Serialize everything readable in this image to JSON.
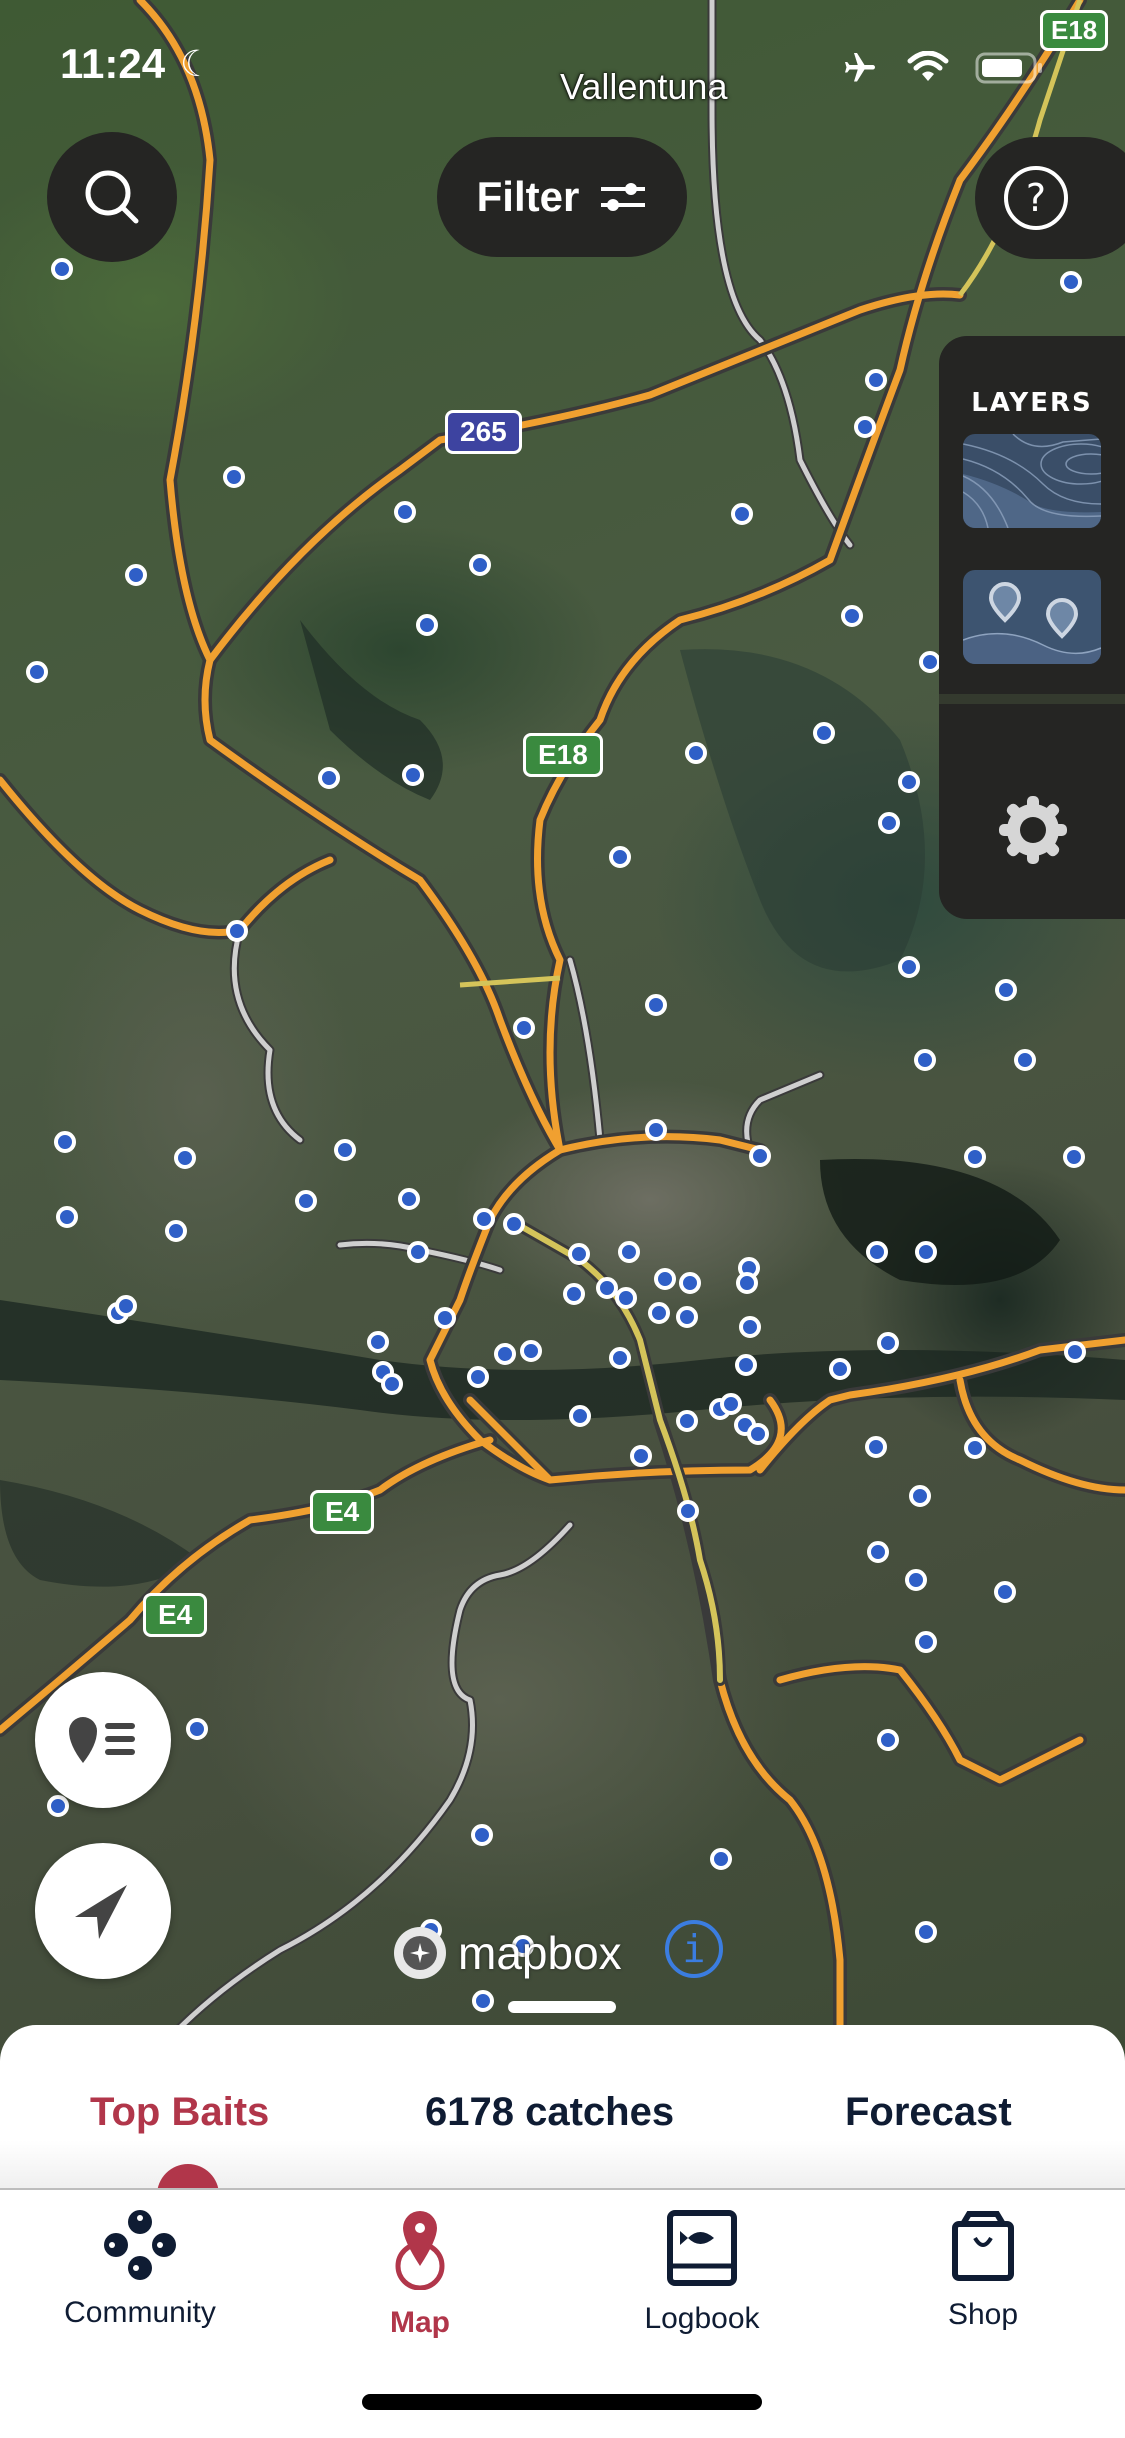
{
  "status_bar": {
    "time": "11:24",
    "icons": [
      "moon-icon",
      "airplane-icon",
      "wifi-icon",
      "battery-icon"
    ]
  },
  "map": {
    "place_label": "Vallentuna",
    "road_shields": [
      {
        "label": "E18",
        "type": "european",
        "color": "#3a8a3f"
      },
      {
        "label": "265",
        "type": "national",
        "color": "#3d43a0"
      },
      {
        "label": "E18",
        "type": "european",
        "color": "#3a8a3f"
      },
      {
        "label": "E4",
        "type": "european",
        "color": "#3a8a3f"
      },
      {
        "label": "E4",
        "type": "european",
        "color": "#3a8a3f"
      }
    ],
    "marker_color": "#2f5fc7",
    "attribution": "mapbox"
  },
  "top_controls": {
    "search_icon": "search-icon",
    "filter_label": "Filter",
    "help_icon": "question-circle-icon"
  },
  "layers_panel": {
    "title": "LAYERS",
    "items": [
      "depth-contours-layer",
      "catch-pins-layer"
    ],
    "settings_icon": "gear-icon"
  },
  "map_buttons": [
    "pin-list-icon",
    "location-arrow-icon"
  ],
  "sheet": {
    "tabs": [
      {
        "label": "Top Baits",
        "active": true
      },
      {
        "label": "6178 catches",
        "active": false
      },
      {
        "label": "Forecast",
        "active": false
      }
    ],
    "accent": "#b1364a"
  },
  "tab_bar": {
    "items": [
      {
        "label": "Community",
        "active": false
      },
      {
        "label": "Map",
        "active": true
      },
      {
        "label": "Logbook",
        "active": false
      },
      {
        "label": "Shop",
        "active": false
      }
    ],
    "active_color": "#b1364a",
    "inactive_color": "#0f1c33"
  }
}
